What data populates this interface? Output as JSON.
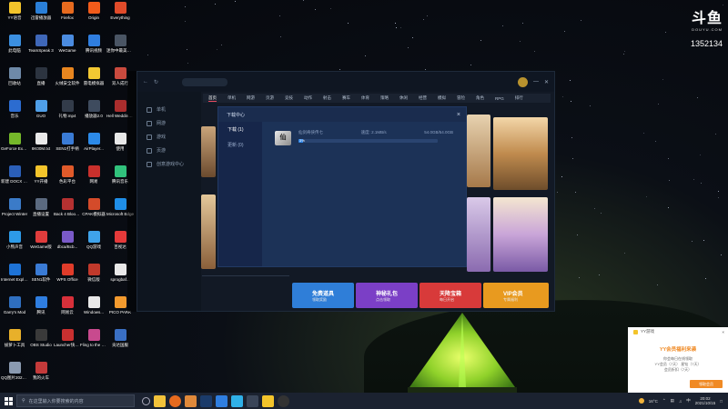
{
  "desktop_icons": [
    {
      "label": "YY语音",
      "color": "#f3c42b"
    },
    {
      "label": "迅雷播放器",
      "color": "#2a7fd8"
    },
    {
      "label": "Firefox",
      "color": "#e66a1e"
    },
    {
      "label": "Origin",
      "color": "#f25b1a"
    },
    {
      "label": "Everything",
      "color": "#e04b2a"
    },
    {
      "label": "微信",
      "color": "#22b14c"
    },
    {
      "label": "此电脑",
      "color": "#3b8fe0"
    },
    {
      "label": "TeamSpeak 3",
      "color": "#3f67b8"
    },
    {
      "label": "WeGame",
      "color": "#4b8ce0"
    },
    {
      "label": "腾讯视频",
      "color": "#2f7ee0"
    },
    {
      "label": "迷你中最美的英.mov",
      "color": "#4a5564"
    },
    {
      "label": "斗鱼直播伴侣",
      "color": "#f07b22"
    },
    {
      "label": "回收站",
      "color": "#6e89a8"
    },
    {
      "label": "直播",
      "color": "#2c3440"
    },
    {
      "label": "火绒安全软件",
      "color": "#e8861f"
    },
    {
      "label": "雷电模拟器",
      "color": "#f2c832"
    },
    {
      "label": "双人成行",
      "color": "#c94a3e"
    },
    {
      "label": "微博",
      "color": "#e23b3b"
    },
    {
      "label": "音乐",
      "color": "#2c6cd0"
    },
    {
      "label": "GUO",
      "color": "#4f9fe8"
    },
    {
      "label": "礼物.mp4",
      "color": "#333c4a"
    },
    {
      "label": "播放器2.0",
      "color": "#3e4b5e"
    },
    {
      "label": "Hell Wedding...",
      "color": "#aa2d2d"
    },
    {
      "label": "游戏",
      "color": "#d8a22a"
    },
    {
      "label": "GeForce Experience",
      "color": "#75b82a"
    },
    {
      "label": "8K00M.txt",
      "color": "#e9e9e9"
    },
    {
      "label": "SEN1打手柄",
      "color": "#3a7bd5"
    },
    {
      "label": "AirPlayer...",
      "color": "#2c8ae8"
    },
    {
      "label": "使用",
      "color": "#e8e8e8"
    },
    {
      "label": "Draw & Guess",
      "color": "#f2a93b"
    },
    {
      "label": "新建 DOCX 文档.docx",
      "color": "#2b5fb8"
    },
    {
      "label": "YY开播",
      "color": "#f3c42b"
    },
    {
      "label": "色彩平台",
      "color": "#e05a2a"
    },
    {
      "label": "网易",
      "color": "#c9302c"
    },
    {
      "label": "腾讯音乐",
      "color": "#31c27c"
    },
    {
      "label": "恢复",
      "color": "#3a8ee6"
    },
    {
      "label": "Project Winter",
      "color": "#3b7bc8"
    },
    {
      "label": "直播设置",
      "color": "#5b6a80"
    },
    {
      "label": "Back 4 Blood Beta",
      "color": "#b53131"
    },
    {
      "label": "CPAK模拟器",
      "color": "#d44b2a"
    },
    {
      "label": "Microsoft Edge",
      "color": "#1f8ee8"
    },
    {
      "label": "每天直播",
      "color": "#d84a2a"
    },
    {
      "label": "小熊声音",
      "color": "#2d9ae8"
    },
    {
      "label": "WeGame版",
      "color": "#e03c3c"
    },
    {
      "label": "dbca/Bcb...",
      "color": "#7a5ac8"
    },
    {
      "label": "QQ游戏",
      "color": "#3fa3ea"
    },
    {
      "label": "百视达",
      "color": "#e53a3a"
    },
    {
      "label": "最新卡丁车",
      "color": "#2a5ed0"
    },
    {
      "label": "Internet Explorer",
      "color": "#1e73d6"
    },
    {
      "label": "SEN1软件",
      "color": "#3a7bd5"
    },
    {
      "label": "WPS Office",
      "color": "#e03c2a"
    },
    {
      "label": "微信版",
      "color": "#c1392b"
    },
    {
      "label": "sprogbaf...",
      "color": "#e8e8e8"
    },
    {
      "label": "QQ游戏",
      "color": "#3fa3ea"
    },
    {
      "label": "Garry's Mod",
      "color": "#2f6fc0"
    },
    {
      "label": "腾讯",
      "color": "#2f7ee0"
    },
    {
      "label": "网易云",
      "color": "#d8303a"
    },
    {
      "label": "Windows...",
      "color": "#e8e8e8"
    },
    {
      "label": "PICO PARK",
      "color": "#f29a2e"
    },
    {
      "label": "mode.dll",
      "color": "#e8e8e8"
    },
    {
      "label": "拔萝卜工具",
      "color": "#e8b02a"
    },
    {
      "label": "OBS Studio",
      "color": "#3a3a3a"
    },
    {
      "label": "Launcher快捷方式",
      "color": "#c93030"
    },
    {
      "label": "Fling to the Finish",
      "color": "#c84a8e"
    },
    {
      "label": "贡达国服",
      "color": "#3a6fc4"
    },
    {
      "label": "up.exe",
      "color": "#e8e8e8"
    },
    {
      "label": "QQ图片20210...",
      "color": "#8a9ab0"
    },
    {
      "label": "我的火车",
      "color": "#c43a3a"
    }
  ],
  "client": {
    "sidebar_items": [
      "单机",
      "网游",
      "游戏",
      "页游",
      "创意游戏中心"
    ],
    "tabs": [
      "首页",
      "单机",
      "网游",
      "页游",
      "竞技",
      "动作",
      "射击",
      "赛车",
      "体育",
      "策略",
      "休闲",
      "经营",
      "模拟",
      "冒险",
      "角色",
      "RPG",
      "排行"
    ],
    "promos": [
      {
        "title": "免费道具",
        "sub": "领取奖励",
        "color": "#2f7ed8"
      },
      {
        "title": "神秘礼包",
        "sub": "点击领取",
        "color": "#7b3fc6"
      },
      {
        "title": "天降宝箱",
        "sub": "每日开启",
        "color": "#d83a3a"
      },
      {
        "title": "VIP会员",
        "sub": "专属福利",
        "color": "#e89a1f"
      }
    ]
  },
  "dialog": {
    "title": "下载中心",
    "tabs": [
      {
        "label": "下载 (1)"
      },
      {
        "label": "更新 (0)"
      }
    ],
    "item": {
      "name": "仙剑奇侠传七",
      "speed": "速度: 2.1MB/s",
      "size": "54.0GB/54.0GB",
      "percent_label": "3%",
      "progress": 0.03
    }
  },
  "douyu": {
    "logo": "斗鱼",
    "sub": "DOUYU.COM",
    "room_id": "1352134"
  },
  "notification": {
    "app": "YY游戏",
    "title": "YY会员福利来袭",
    "text1": "你会每日在线领取",
    "text2": "YY会员（7天）     星钻（7天）",
    "text3": "会员折扣（7天）",
    "button": "领取会员"
  },
  "taskbar": {
    "search_placeholder": "在这里输入你要搜索的内容",
    "weather": "16°C",
    "time": "20:02",
    "date": "2021/10/15",
    "ime": "中"
  }
}
